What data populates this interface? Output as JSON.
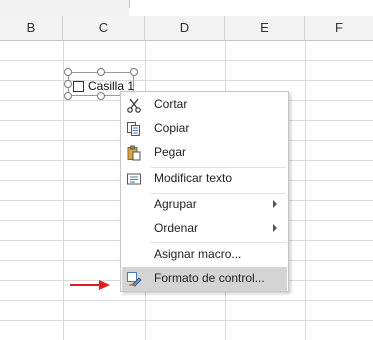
{
  "columns": [
    "B",
    "C",
    "D",
    "E",
    "F"
  ],
  "checkbox": {
    "label": "Casilla 1",
    "checked": false
  },
  "context_menu": {
    "items": [
      {
        "label": "Cortar",
        "icon": "scissors-icon"
      },
      {
        "label": "Copiar",
        "icon": "copy-icon"
      },
      {
        "label": "Pegar",
        "icon": "paste-clipboard-icon"
      },
      {
        "label": "Modificar texto",
        "icon": "edit-text-icon"
      },
      {
        "label": "Agrupar",
        "submenu": true
      },
      {
        "label": "Ordenar",
        "submenu": true
      },
      {
        "label": "Asignar macro..."
      },
      {
        "label": "Formato de control...",
        "icon": "format-control-icon",
        "highlighted": true
      }
    ]
  },
  "colors": {
    "annotation_arrow": "#e02020",
    "highlight": "#d4d4d4",
    "header_bg": "#f3f3f3"
  }
}
